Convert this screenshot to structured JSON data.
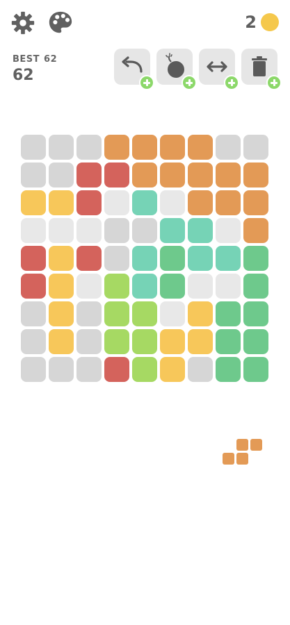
{
  "scores": {
    "best_label": "BEST",
    "best_value": "62",
    "current": "62"
  },
  "coins": {
    "count": "2",
    "coin_icon": "coin-icon"
  },
  "toolbar": {
    "settings_icon": "gear-icon",
    "theme_icon": "palette-icon"
  },
  "powerups": [
    {
      "name": "undo",
      "icon": "undo-icon"
    },
    {
      "name": "bomb",
      "icon": "bomb-icon"
    },
    {
      "name": "swap",
      "icon": "swap-arrows-icon"
    },
    {
      "name": "trash",
      "icon": "trash-icon"
    }
  ],
  "colors": {
    "empty": "#d6d6d6",
    "empty_light": "#e8e8e8",
    "orange": "#e39a56",
    "red": "#d4635c",
    "yellow": "#f7c75a",
    "teal": "#76d3b6",
    "green": "#6ec98c",
    "lime": "#a6d963",
    "plus": "#8cd86a",
    "powerup_bg": "#e6e6e6"
  },
  "board": {
    "rows": 9,
    "cols": 9,
    "cells": [
      [
        "empty",
        "empty",
        "empty",
        "orange",
        "orange",
        "orange",
        "orange",
        "empty",
        "empty"
      ],
      [
        "empty",
        "empty",
        "red",
        "red",
        "orange",
        "orange",
        "orange",
        "orange",
        "orange"
      ],
      [
        "yellow",
        "yellow",
        "red",
        "empty_light",
        "teal",
        "empty_light",
        "orange",
        "orange",
        "orange"
      ],
      [
        "empty_light",
        "empty_light",
        "empty_light",
        "empty",
        "empty",
        "teal",
        "teal",
        "empty_light",
        "orange"
      ],
      [
        "red",
        "yellow",
        "red",
        "empty",
        "teal",
        "green",
        "teal",
        "teal",
        "green"
      ],
      [
        "red",
        "yellow",
        "empty_light",
        "lime",
        "teal",
        "green",
        "empty_light",
        "empty_light",
        "green"
      ],
      [
        "empty",
        "yellow",
        "empty",
        "lime",
        "lime",
        "empty_light",
        "yellow",
        "green",
        "green"
      ],
      [
        "empty",
        "yellow",
        "empty",
        "lime",
        "lime",
        "yellow",
        "yellow",
        "green",
        "green"
      ],
      [
        "empty",
        "empty",
        "empty",
        "red",
        "lime",
        "yellow",
        "empty",
        "green",
        "green"
      ]
    ]
  },
  "next_piece": {
    "color": "orange",
    "cells": [
      [
        0,
        1
      ],
      [
        0,
        2
      ],
      [
        1,
        0
      ],
      [
        1,
        1
      ]
    ]
  }
}
